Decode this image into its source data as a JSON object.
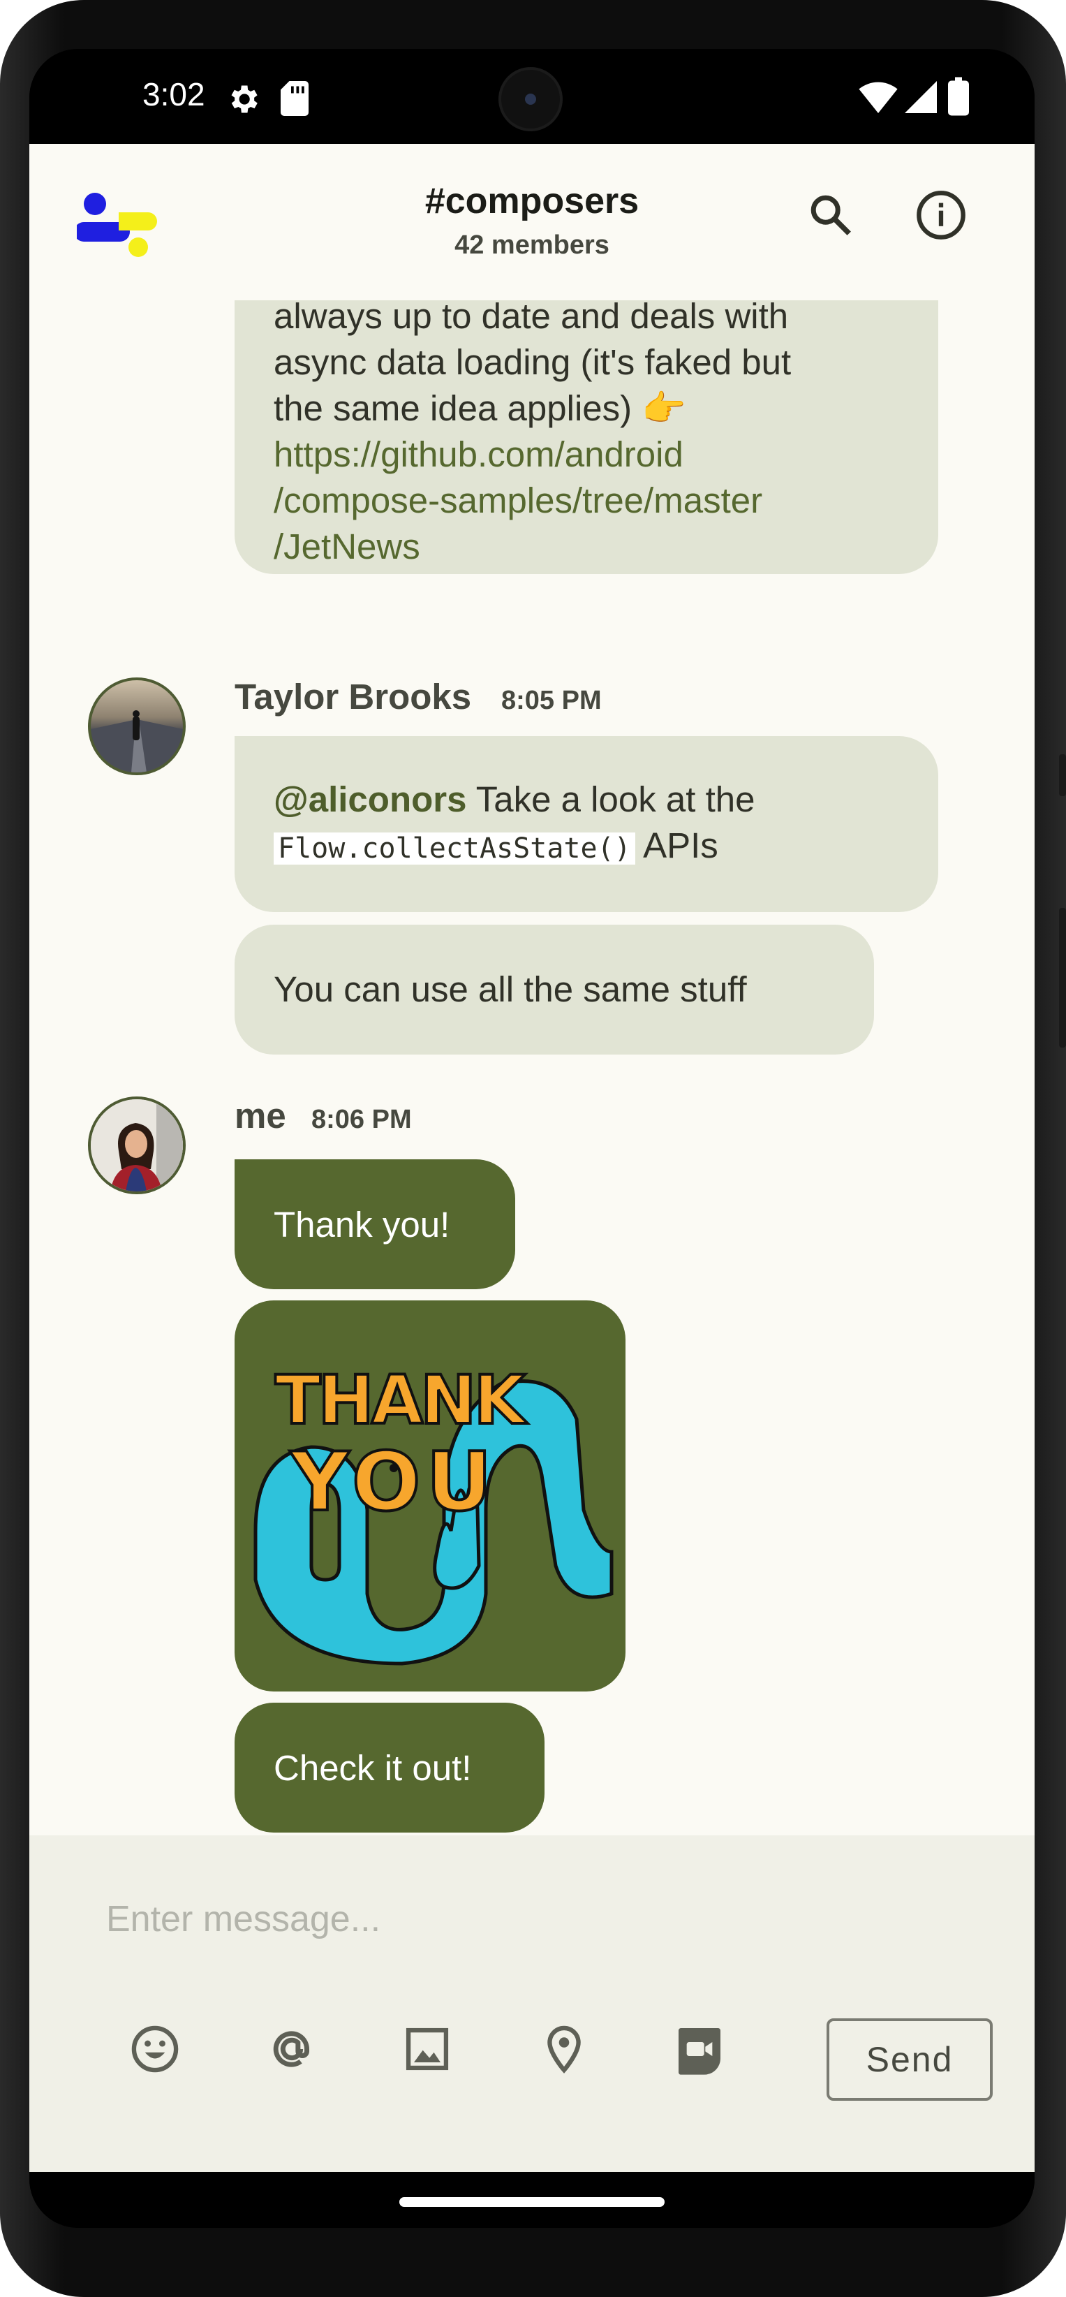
{
  "status_bar": {
    "time": "3:02"
  },
  "header": {
    "title": "#composers",
    "subtitle": "42 members"
  },
  "messages": {
    "truncated_text_line1": "always up to date and deals with",
    "truncated_text_line2": "async data loading (it's faked but",
    "truncated_text_line3": "the same idea applies) 👉",
    "truncated_link_line1": "https://github.com/android",
    "truncated_link_line2": "/compose-samples/tree/master",
    "truncated_link_line3": "/JetNews",
    "taylor": {
      "author": "Taylor Brooks",
      "time": "8:05 PM",
      "msg1_mention": "@aliconors",
      "msg1_text": " Take a look at the",
      "msg1_code": "Flow.collectAsState()",
      "msg1_suffix": " APIs",
      "msg2": "You can use all the same stuff"
    },
    "me": {
      "author": "me",
      "time": "8:06 PM",
      "msg1": "Thank you!",
      "sticker_text_1": "THANK",
      "sticker_text_2": "YOU",
      "msg3": "Check it out!"
    }
  },
  "composer": {
    "placeholder": "Enter message...",
    "send_label": "Send"
  },
  "colors": {
    "bubble_in": "#e1e4d4",
    "bubble_out": "#56682f",
    "background": "#fbfaf4",
    "accent": "#56682f"
  },
  "icons": [
    "settings-icon",
    "sd-card-icon",
    "wifi-icon",
    "signal-icon",
    "battery-icon",
    "search-icon",
    "info-icon",
    "emoji-icon",
    "mention-icon",
    "image-icon",
    "location-icon",
    "video-call-icon"
  ]
}
